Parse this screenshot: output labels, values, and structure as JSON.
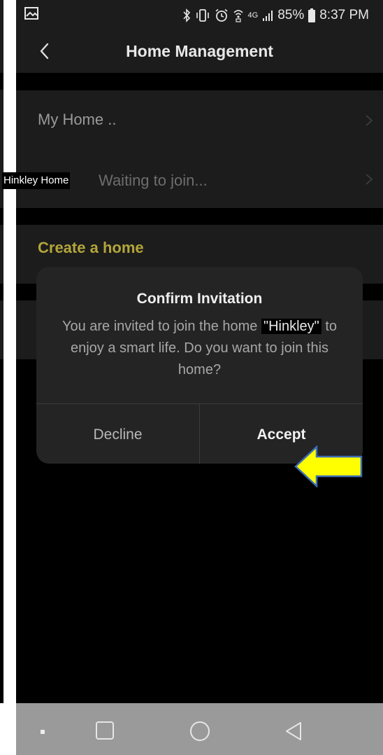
{
  "status_bar": {
    "battery": "85%",
    "time": "8:37 PM",
    "network": "4G",
    "icons": [
      "image-icon",
      "bluetooth-icon",
      "vibrate-icon",
      "alarm-icon",
      "wifi-calling-icon",
      "signal-icon",
      "battery-icon"
    ]
  },
  "app_bar": {
    "title": "Home Management",
    "back_icon": "chevron-left-icon"
  },
  "home_list": {
    "items": [
      {
        "label": "My Home .."
      },
      {
        "tag": "Hinkley Home",
        "label": "Waiting to join..."
      }
    ],
    "create_label": "Create a home"
  },
  "dialog": {
    "title": "Confirm Invitation",
    "message_before": "You are invited to join the home ",
    "home_name": "\"Hinkley\"",
    "message_after": " to enjoy a smart life. Do you want to join this home?",
    "decline_label": "Decline",
    "accept_label": "Accept"
  },
  "colors": {
    "background": "#000000",
    "surface": "#1c1c1c",
    "dialog": "#242424",
    "accent_gold": "#b3a53a",
    "arrow_yellow": "#ffff00",
    "arrow_outline": "#3d6db5",
    "navbar": "#9a9a9a"
  }
}
